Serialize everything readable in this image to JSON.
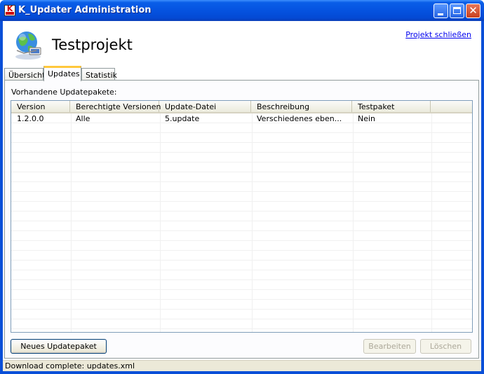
{
  "window": {
    "title": "K_Updater Administration",
    "icon_label": "K"
  },
  "header": {
    "project_title": "Testprojekt",
    "close_project_link": "Projekt schließen"
  },
  "tabs": [
    {
      "label": "Übersicht",
      "active": false
    },
    {
      "label": "Updates",
      "active": true
    },
    {
      "label": "Statistik",
      "active": false
    }
  ],
  "updates": {
    "section_label": "Vorhandene Updatepakete:",
    "columns": [
      "Version",
      "Berechtigte Versionen",
      "Update-Datei",
      "Beschreibung",
      "Testpaket"
    ],
    "rows": [
      [
        "1.2.0.0",
        "Alle",
        "5.update",
        "Verschiedenes eben...",
        "Nein"
      ]
    ]
  },
  "buttons": {
    "new_package": "Neues Updatepaket",
    "edit": "Bearbeiten",
    "delete": "Löschen"
  },
  "status": {
    "text": "Download complete: updates.xml"
  },
  "colors": {
    "titlebar": "#0553e0",
    "active_tab_accent": "#ffc83c",
    "link": "#0000ee"
  }
}
